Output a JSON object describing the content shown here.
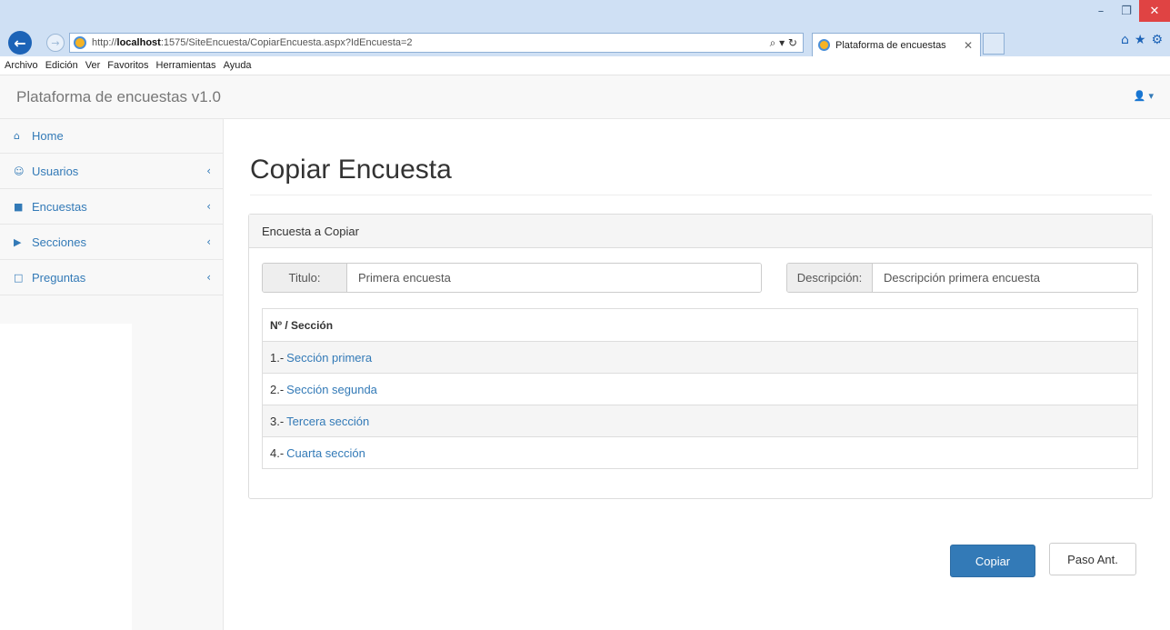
{
  "browser": {
    "url_prefix": "http://",
    "url_host": "localhost",
    "url_rest": ":1575/SiteEncuesta/CopiarEncuesta.aspx?IdEncuesta=2",
    "addr_tools": "⌕ ▾ ↻",
    "tab_title": "Plataforma de encuestas",
    "menu": [
      "Archivo",
      "Edición",
      "Ver",
      "Favoritos",
      "Herramientas",
      "Ayuda"
    ]
  },
  "app": {
    "brand": "Plataforma de encuestas v1.0"
  },
  "sidebar": {
    "items": [
      {
        "label": "Home",
        "icon": "home-icon",
        "glyph": "⌂"
      },
      {
        "label": "Usuarios",
        "icon": "users-icon",
        "glyph": "☺"
      },
      {
        "label": "Encuestas",
        "icon": "bookmark-icon",
        "glyph": "■"
      },
      {
        "label": "Secciones",
        "icon": "tags-icon",
        "glyph": "▶"
      },
      {
        "label": "Preguntas",
        "icon": "bookmark-outline-icon",
        "glyph": "□"
      }
    ]
  },
  "main": {
    "title": "Copiar Encuesta",
    "panel_heading": "Encuesta a Copiar",
    "titulo_label": "Titulo:",
    "titulo_value": "Primera encuesta",
    "descripcion_label": "Descripción:",
    "descripcion_value": "Descripción primera encuesta",
    "table_header": "Nº / Sección",
    "sections": [
      {
        "num": "1.-",
        "name": "Sección primera"
      },
      {
        "num": "2.-",
        "name": "Sección segunda"
      },
      {
        "num": "3.-",
        "name": "Tercera sección"
      },
      {
        "num": "4.-",
        "name": "Cuarta sección"
      }
    ],
    "copy_button": "Copiar",
    "back_button": "Paso Ant."
  },
  "colors": {
    "primary": "#337ab7",
    "link": "#337ab7"
  }
}
